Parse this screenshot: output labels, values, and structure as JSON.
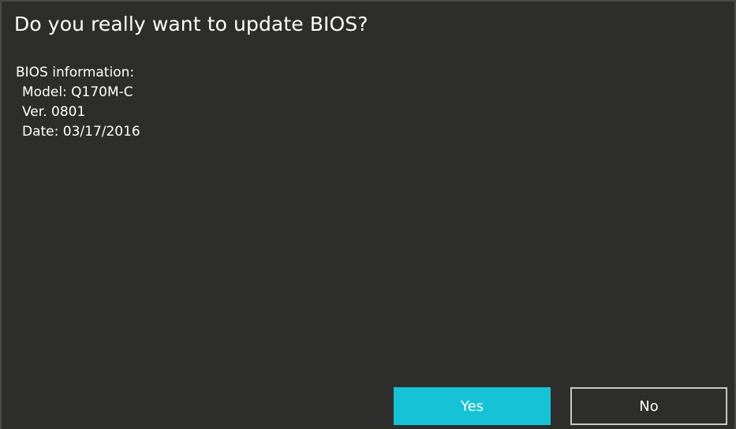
{
  "dialog": {
    "title": "Do you really want to update BIOS?",
    "info": {
      "heading": "BIOS information:",
      "model": "Model: Q170M-C",
      "version": "Ver. 0801",
      "date": "Date: 03/17/2016"
    },
    "buttons": {
      "yes_label": "Yes",
      "no_label": "No"
    }
  },
  "colors": {
    "background": "#2d2e2c",
    "accent": "#16c2d6",
    "text": "#ffffff",
    "button_border": "#c8c8c8"
  }
}
